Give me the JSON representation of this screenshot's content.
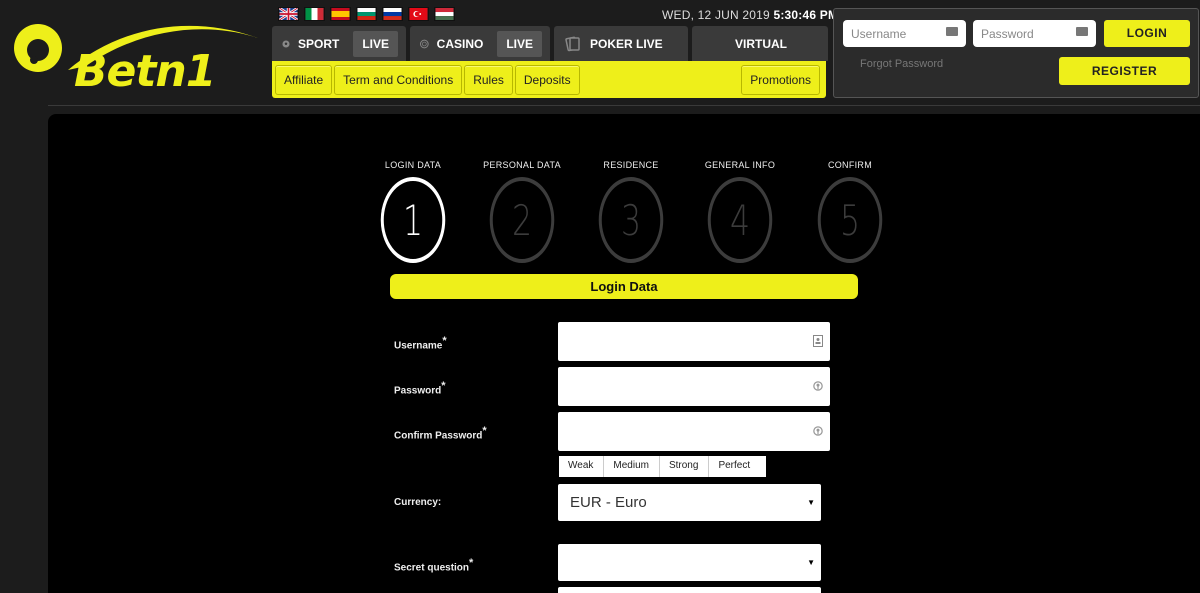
{
  "brand": {
    "name": "Betn1",
    "accent": "#eeef1a"
  },
  "languages": [
    "uk-flag",
    "italy-flag",
    "spain-flag",
    "bulgaria-flag",
    "russia-flag",
    "turkey-flag",
    "hungary-flag"
  ],
  "datetime": {
    "date": "WED, 12 JUN 2019",
    "time": "5:30:46 PM"
  },
  "nav": {
    "sport": "SPORT",
    "casino": "CASINO",
    "live": "LIVE",
    "poker_live": "POKER LIVE",
    "virtual": "VIRTUAL"
  },
  "subnav": {
    "affiliate": "Affiliate",
    "terms": "Term and Conditions",
    "rules": "Rules",
    "deposits": "Deposits",
    "promotions": "Promotions"
  },
  "login": {
    "username_placeholder": "Username",
    "password_placeholder": "Password",
    "login_label": "LOGIN",
    "forgot_label": "Forgot Password",
    "register_label": "REGISTER"
  },
  "steps": [
    {
      "label": "LOGIN DATA",
      "num": "1"
    },
    {
      "label": "PERSONAL DATA",
      "num": "2"
    },
    {
      "label": "RESIDENCE",
      "num": "3"
    },
    {
      "label": "GENERAL INFO",
      "num": "4"
    },
    {
      "label": "CONFIRM",
      "num": "5"
    }
  ],
  "form": {
    "section_title": "Login Data",
    "username_label": "Username",
    "password_label": "Password",
    "confirm_label": "Confirm Password",
    "required_mark": "*",
    "currency_label": "Currency:",
    "currency_value": "EUR - Euro",
    "secret_label": "Secret question",
    "strength": [
      "Weak",
      "Medium",
      "Strong",
      "Perfect"
    ]
  }
}
